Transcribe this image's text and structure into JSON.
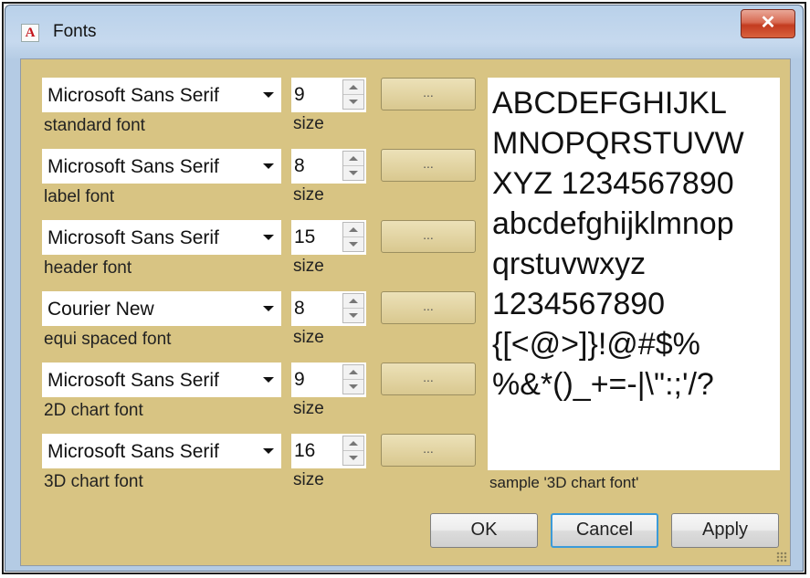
{
  "window": {
    "title": "Fonts",
    "app_icon": "A",
    "close_glyph": "✕"
  },
  "rows": [
    {
      "font": "Microsoft Sans Serif",
      "label": "standard font",
      "size": "9",
      "size_label": "size",
      "button": "..."
    },
    {
      "font": "Microsoft Sans Serif",
      "label": "label font",
      "size": "8",
      "size_label": "size",
      "button": "..."
    },
    {
      "font": "Microsoft Sans Serif",
      "label": "header font",
      "size": "15",
      "size_label": "size",
      "button": "..."
    },
    {
      "font": "Courier New",
      "label": "equi spaced font",
      "size": "8",
      "size_label": "size",
      "button": "..."
    },
    {
      "font": "Microsoft Sans Serif",
      "label": "2D chart font",
      "size": "9",
      "size_label": "size",
      "button": "..."
    },
    {
      "font": "Microsoft Sans Serif",
      "label": "3D chart font",
      "size": "16",
      "size_label": "size",
      "button": "..."
    }
  ],
  "sample": {
    "lines": [
      "ABCDEFGHIJKL",
      "MNOPQRSTUVW",
      "XYZ 1234567890",
      "abcdefghijklmnop",
      "qrstuvwxyz",
      "1234567890",
      "{[<@>]}!@#$%",
      "%&*()_+=-|\\\":;'/?"
    ],
    "caption": "sample '3D chart font'"
  },
  "buttons": {
    "ok": "OK",
    "cancel": "Cancel",
    "apply": "Apply"
  },
  "colors": {
    "client_bg": "#d8c483",
    "focus_border": "#3c9ad8"
  }
}
